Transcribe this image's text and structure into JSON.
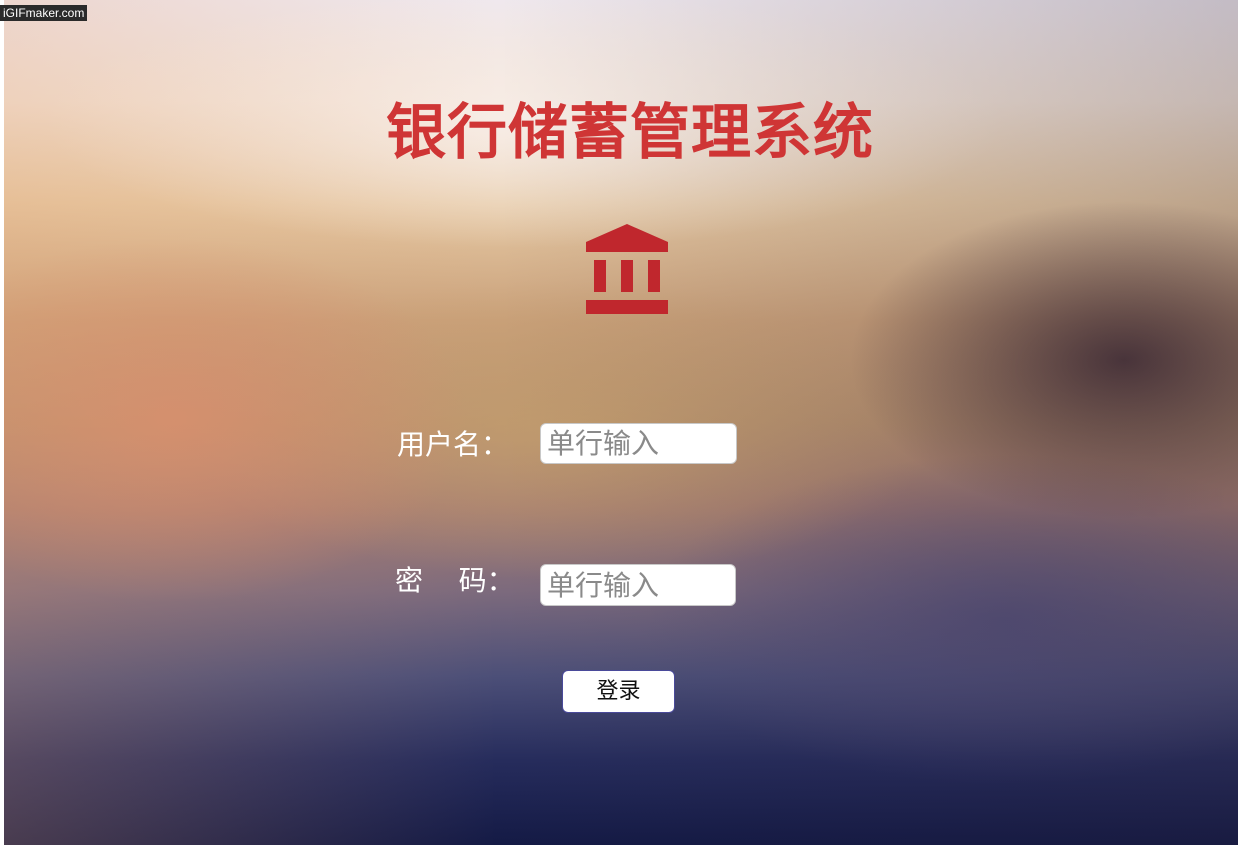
{
  "watermark": "iGIFmaker.com",
  "header": {
    "title": "银行储蓄管理系统",
    "icon": "bank-icon"
  },
  "form": {
    "username_label": "用户名：",
    "username_placeholder": "单行输入",
    "password_label": "密    码：",
    "password_placeholder": "单行输入",
    "login_label": "登录"
  },
  "colors": {
    "title": "#cf3535",
    "icon": "#c0272d",
    "label": "#ffffff",
    "button_border": "#4a4a9a"
  }
}
